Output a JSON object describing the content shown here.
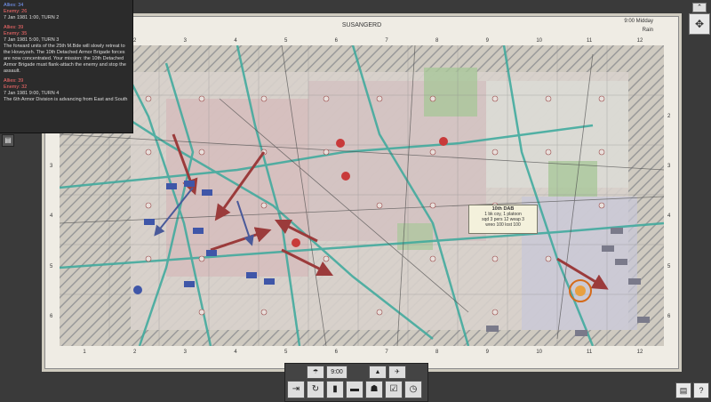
{
  "map": {
    "title": "SUSANGERD",
    "time": "9:00 Midday",
    "weather": "Rain",
    "columns": [
      "1",
      "2",
      "3",
      "4",
      "5",
      "6",
      "7",
      "8",
      "9",
      "10",
      "11",
      "12"
    ],
    "rows": [
      "2",
      "3",
      "4",
      "5",
      "6"
    ]
  },
  "log": {
    "entries": [
      {
        "ally": "Allies: 34",
        "enemy": "Enemy: 26",
        "time": "7 Jan 1981  1:00, TURN 2",
        "text": "..."
      },
      {
        "ally": "Allies: 39",
        "enemy": "Enemy: 35",
        "time": "7 Jan 1981  5:00, TURN 3",
        "text": "The forward units of the 25th M.Bde will slowly retreat to the Hoveyzeh. The 10th Detached Armor Brigade forces are now concentrated. Your mission: the 10th Detached Armor Brigade must flank-attach the enemy and stop the assault."
      },
      {
        "ally": "Allies: 39",
        "enemy": "Enemy: 32",
        "time": "7 Jan 1981  9:00, TURN 4",
        "text": "The 6th Armor Division is advancing from East and South"
      }
    ]
  },
  "unit_tooltip": {
    "name": "10th DAB",
    "line1": "1 bk coy, 1 platoon",
    "line2": "sqd 3 pers 12 weap 3",
    "line3": "wreo 100 lost 100"
  },
  "toolbar": {
    "turn_time": "9:00"
  },
  "icons": {
    "nav_up": "chevron-up-icon",
    "nav_pad": "move-icon",
    "log_toggle": "panel-toggle-icon",
    "manual": "book-icon",
    "help": "help-icon"
  }
}
